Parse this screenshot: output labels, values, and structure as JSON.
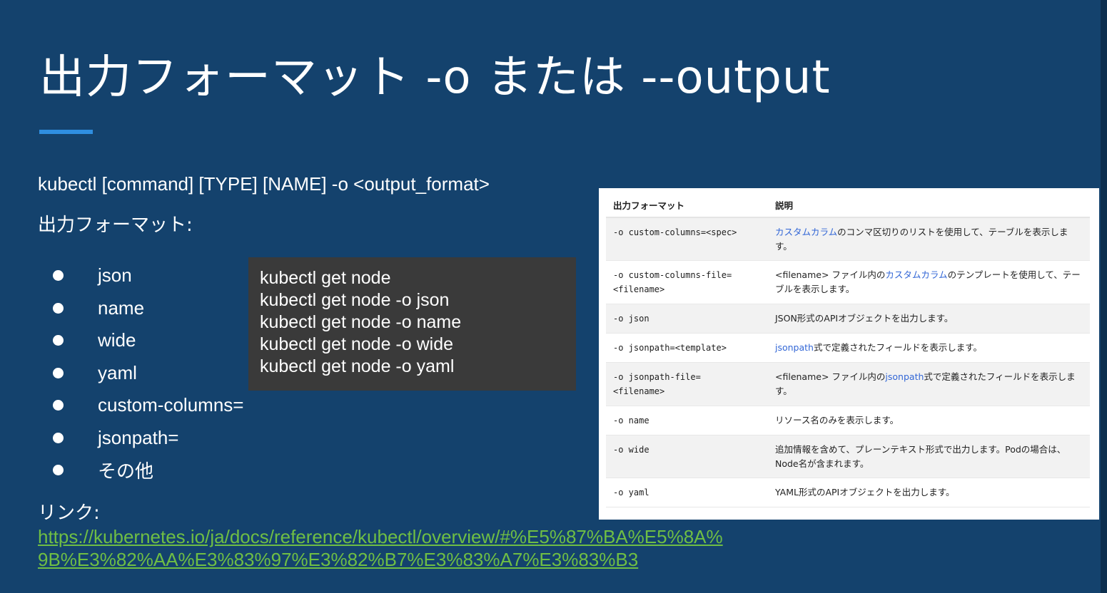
{
  "slide": {
    "title": "出力フォーマット -o または --output",
    "command_line": "kubectl [command] [TYPE] [NAME] -o <output_format>",
    "format_label": "出力フォーマット:",
    "bullets": [
      "json",
      "name",
      "wide",
      "yaml",
      "custom-columns=",
      "jsonpath=",
      "その他"
    ],
    "code_lines": [
      "kubectl get node",
      "kubectl get node -o json",
      "kubectl get node -o name",
      "kubectl get node -o wide",
      "kubectl get node -o yaml"
    ],
    "link_label": "リンク:",
    "link_url": "https://kubernetes.io/ja/docs/reference/kubectl/overview/#%E5%87%BA%E5%8A%9B%E3%82%AA%E3%83%97%E3%82%B7%E3%83%A7%E3%83%B3"
  },
  "table": {
    "headers": [
      "出力フォーマット",
      "説明"
    ],
    "rows": [
      {
        "option_1": "-o custom-columns=<spec>",
        "option_2": "",
        "desc_link": "カスタムカラム",
        "desc_rest": "のコンマ区切りのリストを使用して、テーブルを表示します。"
      },
      {
        "option_1": "-o custom-columns-file=",
        "option_2": "<filename>",
        "desc_pre": " <filename> ファイル内の",
        "desc_link": "カスタムカラム",
        "desc_rest": "のテンプレートを使用して、テーブルを表示します。"
      },
      {
        "option_1": "-o json",
        "desc_rest": "JSON形式のAPIオブジェクトを出力します。"
      },
      {
        "option_1": "-o jsonpath=<template>",
        "desc_link": "jsonpath",
        "desc_rest": "式で定義されたフィールドを表示します。"
      },
      {
        "option_1": "-o jsonpath-file=",
        "option_2": "<filename>",
        "desc_pre": " <filename> ファイル内の",
        "desc_link": "jsonpath",
        "desc_rest": "式で定義されたフィールドを表示します。"
      },
      {
        "option_1": "-o name",
        "desc_rest": "リソース名のみを表示します。"
      },
      {
        "option_1": "-o wide",
        "desc_rest": "追加情報を含めて、プレーンテキスト形式で出力します。Podの場合は、Node名が含まれます。"
      },
      {
        "option_1": "-o yaml",
        "desc_rest": "YAML形式のAPIオブジェクトを出力します。"
      }
    ]
  },
  "colors": {
    "background": "#14426d",
    "accent": "#2f8ee0",
    "link": "#6fbe44",
    "code_bg": "#3a3a3a",
    "table_link": "#3367d6"
  }
}
